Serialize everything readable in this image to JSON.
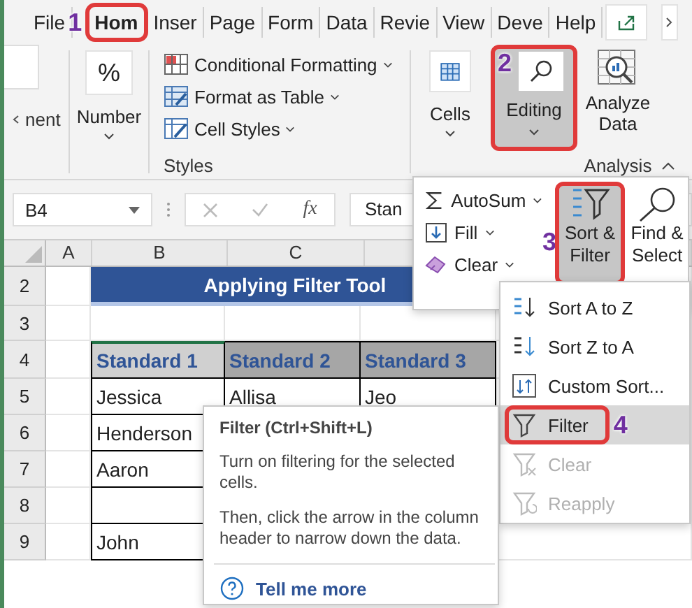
{
  "ribbon_tabs": [
    {
      "label": "File",
      "selected": false
    },
    {
      "label": "Hom",
      "selected": true,
      "badge": "1"
    },
    {
      "label": "Inser",
      "selected": false
    },
    {
      "label": "Page",
      "selected": false
    },
    {
      "label": "Form",
      "selected": false
    },
    {
      "label": "Data",
      "selected": false
    },
    {
      "label": "Revie",
      "selected": false
    },
    {
      "label": "View",
      "selected": false
    },
    {
      "label": "Deve",
      "selected": false
    },
    {
      "label": "Help",
      "selected": false
    }
  ],
  "ribbon": {
    "alignment_label": "nent",
    "number": {
      "symbol": "%",
      "label": "Number"
    },
    "styles": {
      "items": [
        {
          "label": "Conditional Formatting",
          "kind": "conditional"
        },
        {
          "label": "Format as Table",
          "kind": "table"
        },
        {
          "label": "Cell Styles",
          "kind": "styles"
        }
      ],
      "group_label": "Styles"
    },
    "cells": {
      "label": "Cells"
    },
    "editing": {
      "label": "Editing",
      "selected": true,
      "badge": "2"
    },
    "analyze": {
      "label": "Analyze Data",
      "group_label": "Analysis"
    }
  },
  "formula_bar": {
    "name_box": "B4",
    "function_label": "fx",
    "value": "Stan"
  },
  "sheet": {
    "columns": [
      "A",
      "B",
      "C"
    ],
    "rows": [
      {
        "number": "2",
        "kind": "title",
        "cells": [
          "Applying Filter Tool"
        ]
      },
      {
        "number": "3",
        "kind": "blank"
      },
      {
        "number": "4",
        "kind": "header",
        "cells": [
          "Standard 1",
          "Standard 2",
          "Standard 3"
        ]
      },
      {
        "number": "5",
        "kind": "data",
        "cells": [
          "Jessica",
          "Allisa",
          "Jeo"
        ]
      },
      {
        "number": "6",
        "kind": "data",
        "cells": [
          "Henderson"
        ]
      },
      {
        "number": "7",
        "kind": "data",
        "cells": [
          "Aaron"
        ]
      },
      {
        "number": "8",
        "kind": "data"
      },
      {
        "number": "9",
        "kind": "data",
        "cells": [
          "John"
        ]
      }
    ]
  },
  "editing_menu": {
    "items": [
      {
        "label": "AutoSum",
        "kind": "autosum"
      },
      {
        "label": "Fill",
        "kind": "fill"
      },
      {
        "label": "Clear",
        "kind": "clear"
      }
    ],
    "big_buttons": [
      {
        "label": "Sort & Filter",
        "kind": "sort-filter",
        "selected": true,
        "badge": "3"
      },
      {
        "label": "Find & Select",
        "kind": "find",
        "selected": false
      }
    ]
  },
  "sort_filter_menu": [
    {
      "label": "Sort A to Z",
      "kind": "sort-asc",
      "selected": false,
      "disabled": false
    },
    {
      "label": "Sort Z to A",
      "kind": "sort-desc",
      "selected": false,
      "disabled": false
    },
    {
      "label": "Custom Sort...",
      "kind": "custom",
      "selected": false,
      "disabled": false
    },
    {
      "label": "Filter",
      "kind": "filter",
      "selected": true,
      "disabled": false,
      "badge": "4"
    },
    {
      "label": "Clear",
      "kind": "clear-filter",
      "selected": false,
      "disabled": true
    },
    {
      "label": "Reapply",
      "kind": "reapply",
      "selected": false,
      "disabled": true
    }
  ],
  "tooltip": {
    "title": "Filter (Ctrl+Shift+L)",
    "paragraphs": [
      "Turn on filtering for the selected cells.",
      "Then, click the arrow in the column header to narrow down the data."
    ],
    "link": "Tell me more"
  }
}
